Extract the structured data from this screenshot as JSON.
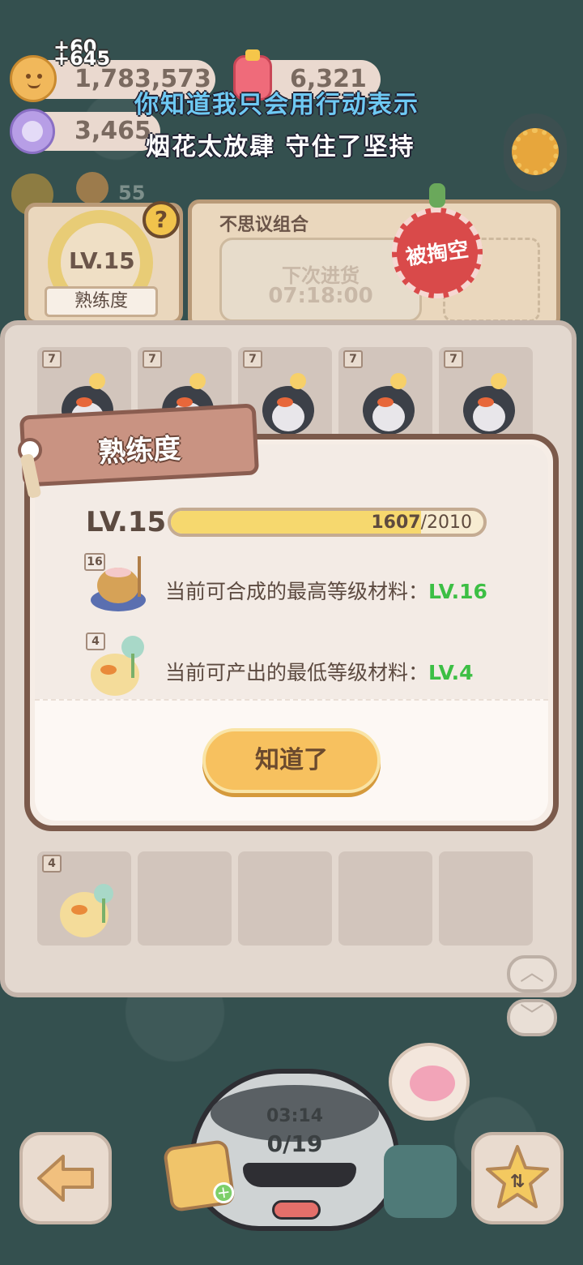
{
  "currencies": {
    "coins": "1,783,573",
    "coins_gain": "+645",
    "coins_gain_prev": "+60",
    "gems": "6,321",
    "candy": "3,465"
  },
  "lyrics": {
    "line1": "你知道我只会用行动表示",
    "line2": "烟花太放肆 守住了坚持"
  },
  "hud": {
    "sub_count": "55"
  },
  "proficiency_card": {
    "level": "LV.15",
    "label": "熟练度",
    "help": "?"
  },
  "shop": {
    "title": "不思议组合",
    "next_restock_label": "下次进货",
    "next_restock_time": "07:18:00",
    "sold_out_stamp": "被掏空"
  },
  "board": {
    "top_row_badge": "7",
    "bottom_item_badge": "4"
  },
  "dialog": {
    "title": "熟练度",
    "level": "LV.15",
    "progress_current": "1607",
    "progress_sep": "/",
    "progress_max": "2010",
    "progress_fraction": 0.7995,
    "row1": {
      "badge": "16",
      "text": "当前可合成的最高等级材料",
      "colon": "：",
      "value": "LV.16"
    },
    "row2": {
      "badge": "4",
      "text": "当前可产出的最低等级材料",
      "colon": "：",
      "value": "LV.4"
    },
    "ok_label": "知道了"
  },
  "pot": {
    "timer": "03:14",
    "count": "0/19"
  },
  "colors": {
    "accent_green": "#3cbf44",
    "button_yellow": "#f7c15f",
    "progress_fill": "#f6d86e"
  }
}
